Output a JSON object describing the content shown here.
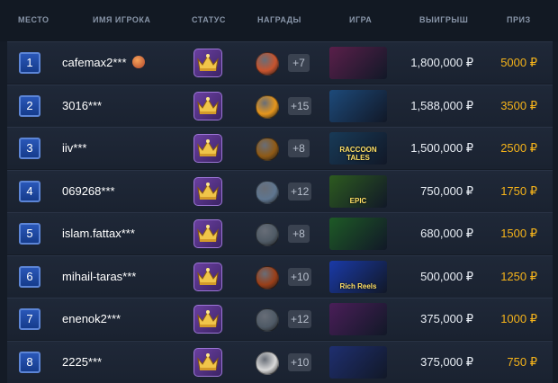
{
  "columns": {
    "place": "Место",
    "player": "Имя игрока",
    "status": "Статус",
    "awards": "Награды",
    "game": "Игра",
    "winnings": "Выигрыш",
    "prize": "Приз"
  },
  "rows": [
    {
      "rank": "1",
      "name": "cafemax2***",
      "award_more": "+7",
      "winnings": "1,800,000 ₽",
      "prize": "5000 ₽",
      "award_color": "#c8542e",
      "game_bg": "#5a1f4a",
      "game_title": "",
      "has_name_badge": true
    },
    {
      "rank": "2",
      "name": "3016***",
      "award_more": "+15",
      "winnings": "1,588,000 ₽",
      "prize": "3500 ₽",
      "award_color": "#e6961c",
      "game_bg": "#1d4a7a",
      "game_title": "",
      "has_name_badge": false
    },
    {
      "rank": "3",
      "name": "iiv***",
      "award_more": "+8",
      "winnings": "1,500,000 ₽",
      "prize": "2500 ₽",
      "award_color": "#8f5a16",
      "game_bg": "#183a57",
      "game_title": "RACCOON TALES",
      "has_name_badge": false
    },
    {
      "rank": "4",
      "name": "069268***",
      "award_more": "+12",
      "winnings": "750,000 ₽",
      "prize": "1750 ₽",
      "award_color": "#5f7690",
      "game_bg": "#2d5a1f",
      "game_title": "EPIC",
      "has_name_badge": false
    },
    {
      "rank": "5",
      "name": "islam.fattax***",
      "award_more": "+8",
      "winnings": "680,000 ₽",
      "prize": "1500 ₽",
      "award_color": "#505b66",
      "game_bg": "#1e5a26",
      "game_title": "",
      "has_name_badge": false
    },
    {
      "rank": "6",
      "name": "mihail-taras***",
      "award_more": "+10",
      "winnings": "500,000 ₽",
      "prize": "1250 ₽",
      "award_color": "#9a3f19",
      "game_bg": "#1a3aa8",
      "game_title": "Rich Reels",
      "has_name_badge": false
    },
    {
      "rank": "7",
      "name": "enenok2***",
      "award_more": "+12",
      "winnings": "375,000 ₽",
      "prize": "1000 ₽",
      "award_color": "#4f5a66",
      "game_bg": "#4a1e58",
      "game_title": "",
      "has_name_badge": false
    },
    {
      "rank": "8",
      "name": "2225***",
      "award_more": "+10",
      "winnings": "375,000 ₽",
      "prize": "750 ₽",
      "award_color": "#d9d9d9",
      "game_bg": "#1f2f70",
      "game_title": "",
      "has_name_badge": false
    }
  ],
  "colors": {
    "accent_prize": "#f5b31a",
    "rank_blue": "#2a57b8",
    "status_purple": "#6a3fa0"
  },
  "icons": {
    "status": "crown-icon",
    "award": "medal-icon",
    "name_badge": "flame-badge-icon"
  }
}
